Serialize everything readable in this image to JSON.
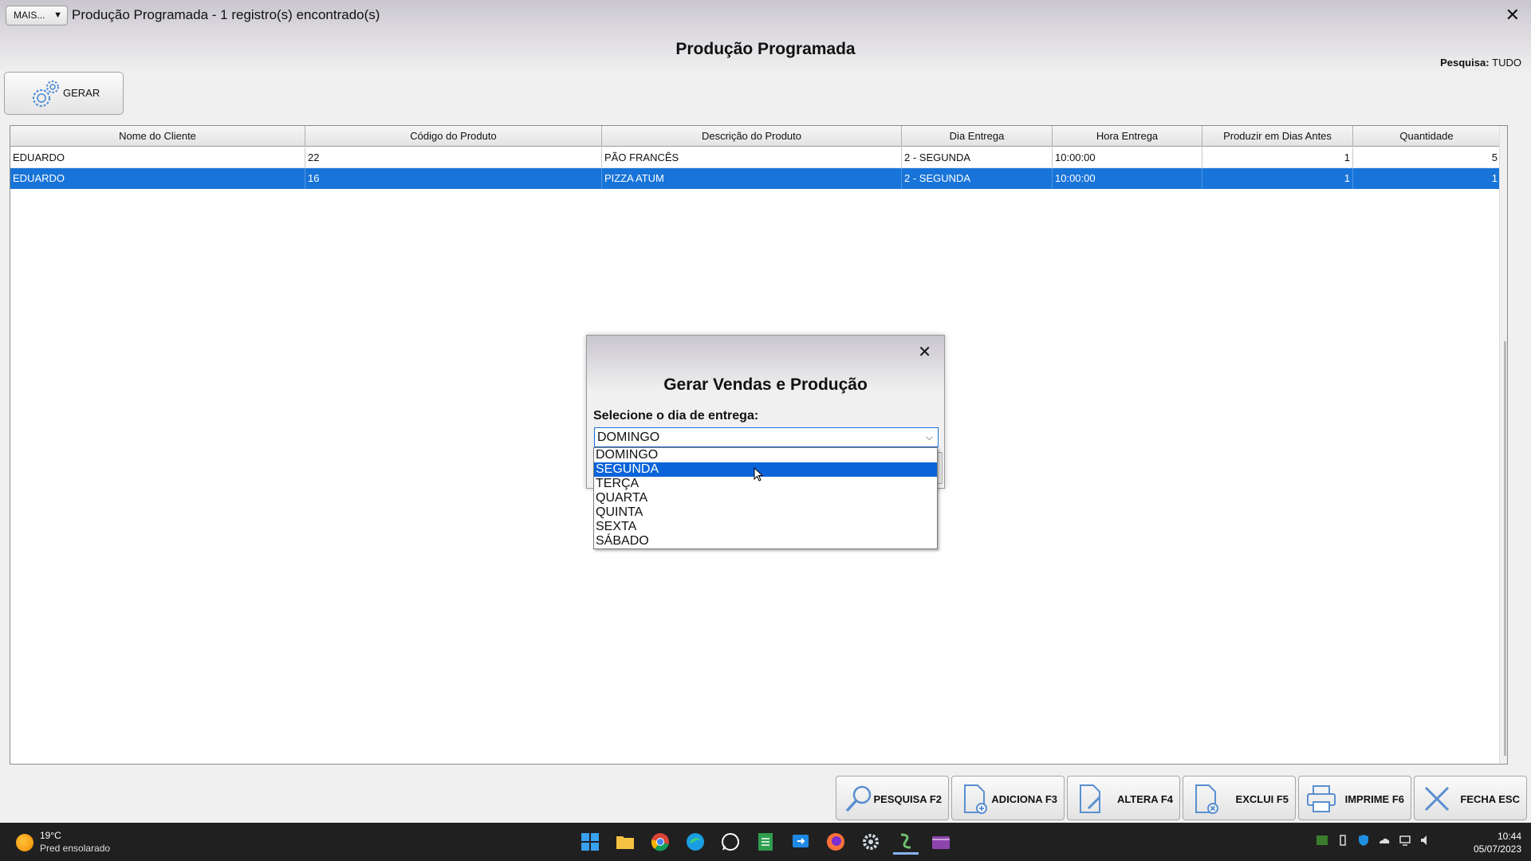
{
  "window": {
    "mais_label": "MAIS...",
    "title": "Produção Programada - 1 registro(s) encontrado(s)",
    "close": "✕"
  },
  "header": {
    "page_title": "Produção Programada",
    "pesquisa_label": "Pesquisa:",
    "pesquisa_value": "TUDO",
    "gerar_label": "GERAR"
  },
  "grid": {
    "columns": [
      "Nome do Cliente",
      "Código do Produto",
      "Descrição do Produto",
      "Dia Entrega",
      "Hora Entrega",
      "Produzir em Dias Antes",
      "Quantidade"
    ],
    "rows": [
      [
        "EDUARDO",
        "22",
        "PÃO FRANCÊS",
        "2 - SEGUNDA",
        "10:00:00",
        "1",
        "5"
      ],
      [
        "EDUARDO",
        "16",
        "PIZZA ATUM",
        "2 - SEGUNDA",
        "10:00:00",
        "1",
        "1"
      ]
    ],
    "selected_row": 1
  },
  "modal": {
    "close": "✕",
    "title": "Gerar Vendas e Produção",
    "label": "Selecione o dia de entrega:",
    "selected_value": "DOMINGO",
    "options": [
      "DOMINGO",
      "SEGUNDA",
      "TERÇA",
      "QUARTA",
      "QUINTA",
      "SEXTA",
      "SÁBADO"
    ],
    "highlighted_option": 1
  },
  "toolbar": {
    "pesquisa": "PESQUISA F2",
    "adiciona": "ADICIONA F3",
    "altera": "ALTERA F4",
    "exclui": "EXCLUI F5",
    "imprime": "IMPRIME F6",
    "fecha": "FECHA ESC"
  },
  "taskbar": {
    "temperature": "19°C",
    "weather": "Pred ensolarado",
    "time": "10:44",
    "date": "05/07/2023"
  },
  "colors": {
    "selection": "#1874d8",
    "taskbar": "#202020"
  }
}
